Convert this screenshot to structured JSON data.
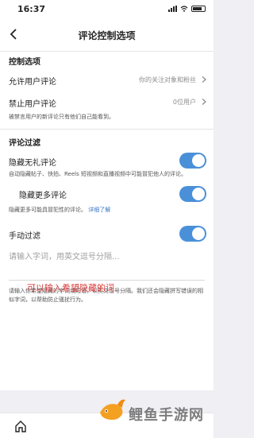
{
  "status_bar": {
    "time": "16:37"
  },
  "header": {
    "title": "评论控制选项"
  },
  "controls": {
    "section_title": "控制选项",
    "allow_comments": {
      "label": "允许用户评论",
      "value": "你的关注对象和粉丝"
    },
    "block_comments": {
      "label": "禁止用户评论",
      "value": "0位用户"
    },
    "block_note": "被禁言用户的新评论只有他们自己能看到。"
  },
  "filters": {
    "section_title": "评论过滤",
    "hide_offensive": {
      "label": "隐藏无礼评论",
      "note": "自动隐藏帖子、快拍、Reels 短视频和直播视频中可能冒犯他人的评论。",
      "enabled": true
    },
    "hide_more": {
      "label": "隐藏更多评论",
      "note": "隐藏更多可能具冒犯性的评论。",
      "link": "详细了解",
      "enabled": true
    },
    "manual_filter": {
      "label": "手动过滤",
      "placeholder": "请输入字词，用英文逗号分隔...",
      "overlay_hint": "可以输入希望隐藏的词",
      "note": "请输入你希望隐藏的字词或短语，以英文逗号分隔。我们还会隐藏拼写错误的相似字词，以帮助防止骚扰行为。",
      "enabled": true
    }
  },
  "watermark": "鲤鱼手游网",
  "colors": {
    "accent": "#4a90d9",
    "hint": "#d93a3a"
  }
}
